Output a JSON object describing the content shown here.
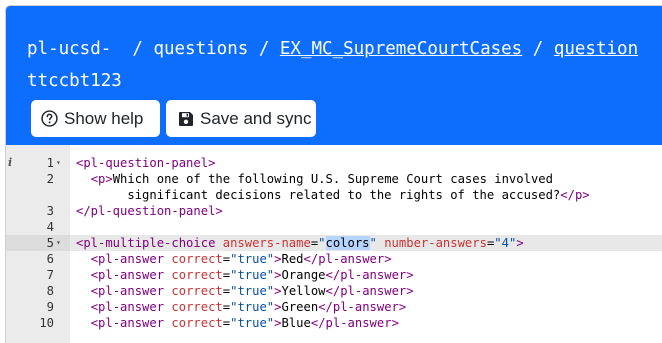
{
  "header": {
    "course": "pl-ucsd-",
    "sep1": "  / ",
    "questions_label": "questions",
    "sep2": " / ",
    "question_name": "EX_MC_SupremeCourtCases",
    "sep3": " / ",
    "question_link": "question",
    "qid": "ttccbt123",
    "help_button": "Show help",
    "save_button": "Save and sync",
    "colors": {
      "bar": "#0d6efd"
    }
  },
  "editor": {
    "lines": [
      {
        "num": "1",
        "fold": "▾",
        "info": "i",
        "parts": [
          [
            "tag",
            "<pl-question-panel>"
          ]
        ]
      },
      {
        "num": "2",
        "fold": "",
        "info": "",
        "parts": [
          [
            "txt",
            "  "
          ],
          [
            "tag",
            "<p>"
          ],
          [
            "txt",
            "Which one of the following U.S. Supreme Court cases involved"
          ]
        ]
      },
      {
        "num": "",
        "fold": "",
        "info": "",
        "parts": [
          [
            "txt",
            "       significant decisions related to the rights of the accused?"
          ],
          [
            "tag",
            "</p>"
          ]
        ]
      },
      {
        "num": "3",
        "fold": "",
        "info": "",
        "parts": [
          [
            "tag",
            "</pl-question-panel>"
          ]
        ]
      },
      {
        "num": "4",
        "fold": "",
        "info": "",
        "parts": []
      },
      {
        "num": "5",
        "fold": "▾",
        "info": "",
        "active": true,
        "parts": [
          [
            "tag",
            "<pl-multiple-choice "
          ],
          [
            "attr",
            "answers-name"
          ],
          [
            "txt",
            "="
          ],
          [
            "val",
            "\""
          ],
          [
            "hl",
            "colors"
          ],
          [
            "val",
            "\""
          ],
          [
            "txt",
            " "
          ],
          [
            "attr",
            "number-answers"
          ],
          [
            "txt",
            "="
          ],
          [
            "val",
            "\"4\""
          ],
          [
            "tag",
            ">"
          ]
        ]
      },
      {
        "num": "6",
        "fold": "",
        "info": "",
        "parts": [
          [
            "txt",
            "  "
          ],
          [
            "tag",
            "<pl-answer "
          ],
          [
            "attr",
            "correct"
          ],
          [
            "txt",
            "="
          ],
          [
            "val",
            "\"true\""
          ],
          [
            "tag",
            ">"
          ],
          [
            "txt",
            "Red"
          ],
          [
            "tag",
            "</pl-answer>"
          ]
        ]
      },
      {
        "num": "7",
        "fold": "",
        "info": "",
        "parts": [
          [
            "txt",
            "  "
          ],
          [
            "tag",
            "<pl-answer "
          ],
          [
            "attr",
            "correct"
          ],
          [
            "txt",
            "="
          ],
          [
            "val",
            "\"true\""
          ],
          [
            "tag",
            ">"
          ],
          [
            "txt",
            "Orange"
          ],
          [
            "tag",
            "</pl-answer>"
          ]
        ]
      },
      {
        "num": "8",
        "fold": "",
        "info": "",
        "parts": [
          [
            "txt",
            "  "
          ],
          [
            "tag",
            "<pl-answer "
          ],
          [
            "attr",
            "correct"
          ],
          [
            "txt",
            "="
          ],
          [
            "val",
            "\"true\""
          ],
          [
            "tag",
            ">"
          ],
          [
            "txt",
            "Yellow"
          ],
          [
            "tag",
            "</pl-answer>"
          ]
        ]
      },
      {
        "num": "9",
        "fold": "",
        "info": "",
        "parts": [
          [
            "txt",
            "  "
          ],
          [
            "tag",
            "<pl-answer "
          ],
          [
            "attr",
            "correct"
          ],
          [
            "txt",
            "="
          ],
          [
            "val",
            "\"true\""
          ],
          [
            "tag",
            ">"
          ],
          [
            "txt",
            "Green"
          ],
          [
            "tag",
            "</pl-answer>"
          ]
        ]
      },
      {
        "num": "10",
        "fold": "",
        "info": "",
        "parts": [
          [
            "txt",
            "  "
          ],
          [
            "tag",
            "<pl-answer "
          ],
          [
            "attr",
            "correct"
          ],
          [
            "txt",
            "="
          ],
          [
            "val",
            "\"true\""
          ],
          [
            "tag",
            ">"
          ],
          [
            "txt",
            "Blue"
          ],
          [
            "tag",
            "</pl-answer>"
          ]
        ]
      }
    ]
  }
}
